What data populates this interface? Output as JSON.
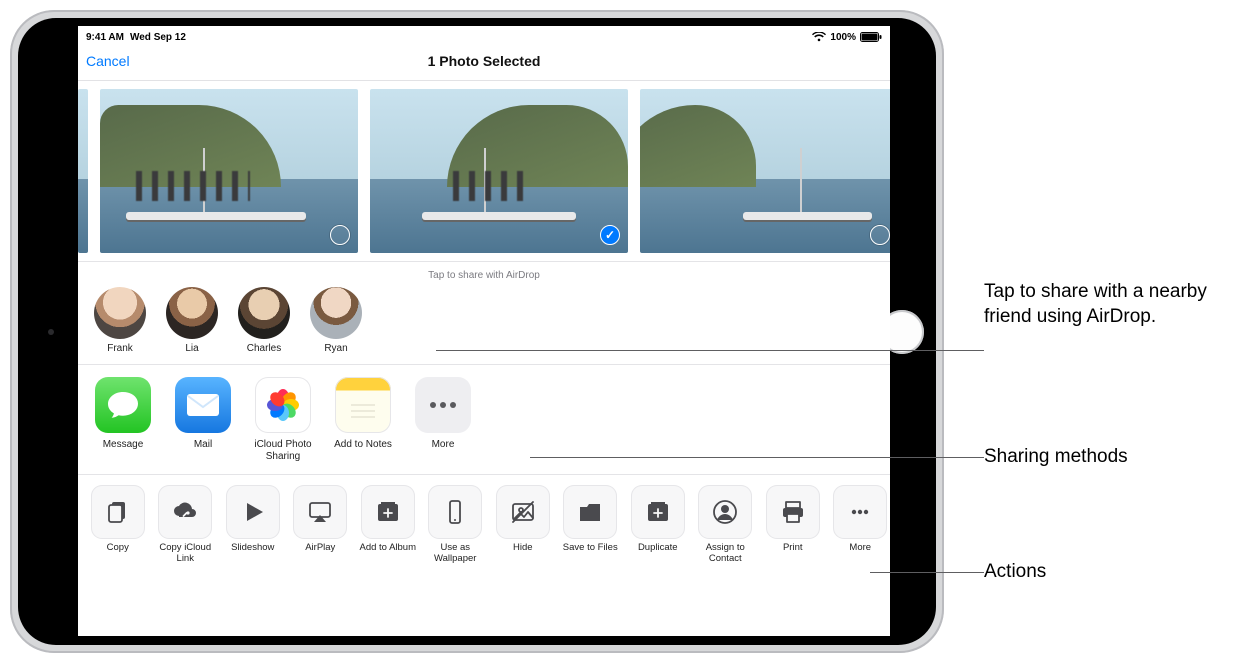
{
  "status": {
    "time": "9:41 AM",
    "date": "Wed Sep 12",
    "battery_pct": "100%"
  },
  "nav": {
    "back_label": "Cancel",
    "title": "1 Photo Selected"
  },
  "photostrip": {
    "tiles": [
      {
        "selected": false
      },
      {
        "selected": true
      },
      {
        "selected": false
      }
    ]
  },
  "airdrop": {
    "hint": "Tap to share with AirDrop",
    "contacts": [
      {
        "name": "Frank"
      },
      {
        "name": "Lia"
      },
      {
        "name": "Charles"
      },
      {
        "name": "Ryan"
      }
    ]
  },
  "apps": {
    "items": [
      {
        "label": "Message",
        "icon": "message-icon"
      },
      {
        "label": "Mail",
        "icon": "mail-icon"
      },
      {
        "label": "iCloud Photo Sharing",
        "icon": "photos-icon"
      },
      {
        "label": "Add to Notes",
        "icon": "notes-icon"
      },
      {
        "label": "More",
        "icon": "more-icon"
      }
    ]
  },
  "actions": {
    "items": [
      {
        "label": "Copy",
        "icon": "copy-icon"
      },
      {
        "label": "Copy iCloud Link",
        "icon": "cloud-link-icon"
      },
      {
        "label": "Slideshow",
        "icon": "play-icon"
      },
      {
        "label": "AirPlay",
        "icon": "airplay-icon"
      },
      {
        "label": "Add to Album",
        "icon": "add-album-icon"
      },
      {
        "label": "Use as Wallpaper",
        "icon": "wallpaper-icon"
      },
      {
        "label": "Hide",
        "icon": "hide-icon"
      },
      {
        "label": "Save to Files",
        "icon": "save-files-icon"
      },
      {
        "label": "Duplicate",
        "icon": "duplicate-icon"
      },
      {
        "label": "Assign to Contact",
        "icon": "assign-contact-icon"
      },
      {
        "label": "Print",
        "icon": "print-icon"
      },
      {
        "label": "More",
        "icon": "more-dots-icon"
      }
    ]
  },
  "callouts": {
    "airdrop": "Tap to share with a nearby friend using AirDrop.",
    "apps": "Sharing methods",
    "actions": "Actions"
  }
}
